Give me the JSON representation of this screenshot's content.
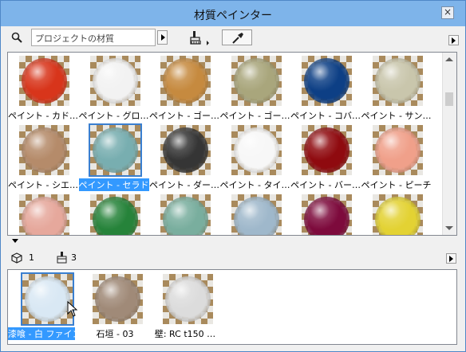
{
  "window": {
    "title": "材質ペインター",
    "close_label": "×"
  },
  "toolbar": {
    "search_placeholder": "プロジェクトの材質",
    "icons": [
      "search-icon",
      "paint-brush-icon",
      "eyedropper-icon"
    ]
  },
  "materials": [
    {
      "label": "ペイント - カド…",
      "color": "#d8351b"
    },
    {
      "label": "ペイント - グロ…",
      "color": "#f2f2f2"
    },
    {
      "label": "ペイント - ゴー…",
      "color": "#c68a3f"
    },
    {
      "label": "ペイント - ゴー…",
      "color": "#a9a67c"
    },
    {
      "label": "ペイント - コバ…",
      "color": "#0d3f85"
    },
    {
      "label": "ペイント - サン…",
      "color": "#c9c6ac"
    },
    {
      "label": "ペイント - シエ…",
      "color": "#b58b6a"
    },
    {
      "label": "ペイント - セラドン",
      "color": "#78aeb0",
      "selected": true
    },
    {
      "label": "ペイント - ダー…",
      "color": "#353535"
    },
    {
      "label": "ペイント - タイ…",
      "color": "#f7f7f7"
    },
    {
      "label": "ペイント - バー…",
      "color": "#8f0a0f"
    },
    {
      "label": "ペイント - ピーチ",
      "color": "#f0a08a"
    },
    {
      "label": "",
      "color": "#e6a89c"
    },
    {
      "label": "",
      "color": "#26833a"
    },
    {
      "label": "",
      "color": "#79ae9e"
    },
    {
      "label": "",
      "color": "#9fb8cb"
    },
    {
      "label": "",
      "color": "#7d0a3c"
    },
    {
      "label": "",
      "color": "#e3d233"
    }
  ],
  "info": {
    "element_count": "1",
    "surface_count": "3"
  },
  "used_materials": [
    {
      "label": "漆喰 - 白 ファイン",
      "color": "#d9e8f4",
      "selected": true
    },
    {
      "label": "石垣 - 03",
      "color": "#a08a78"
    },
    {
      "label": "壁: RC t150 …",
      "color": "#dcdcdc"
    }
  ]
}
